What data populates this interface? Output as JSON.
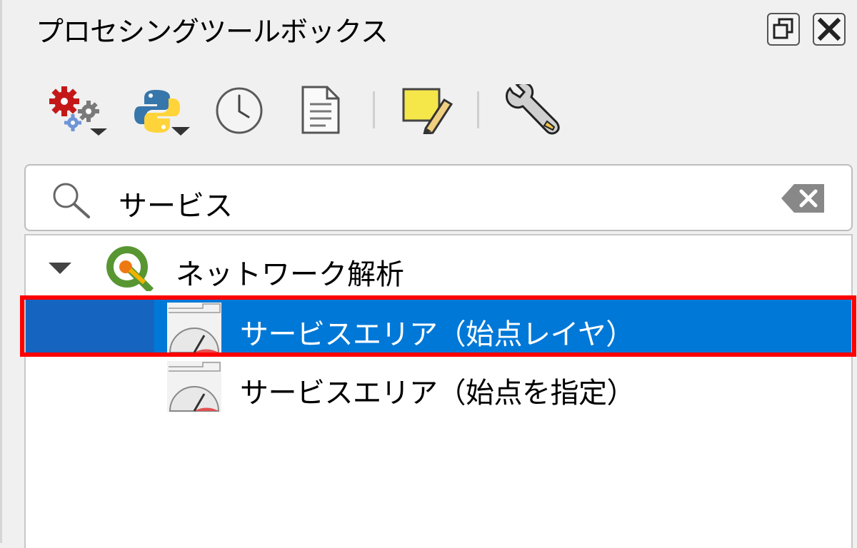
{
  "panel": {
    "title": "プロセシングツールボックス",
    "float_button_icon": "restore-icon",
    "close_button_icon": "close-icon"
  },
  "toolbar": {
    "items": [
      {
        "icon": "models-gear-icon",
        "has_dropdown": true
      },
      {
        "icon": "python-scripts-icon",
        "has_dropdown": true
      },
      {
        "icon": "history-clock-icon",
        "has_dropdown": false
      },
      {
        "icon": "results-document-icon",
        "has_dropdown": false
      },
      {
        "icon": "edit-features-in-place-icon",
        "has_dropdown": false
      },
      {
        "icon": "options-wrench-icon",
        "has_dropdown": false
      }
    ]
  },
  "search": {
    "value": "サービス",
    "clear_icon": "clear-icon"
  },
  "tree": {
    "group": {
      "label": "ネットワーク解析",
      "icon": "qgis-logo-icon",
      "expanded": true
    },
    "items": [
      {
        "label": "サービスエリア（始点レイヤ）",
        "icon": "service-area-gauge-icon",
        "selected": true
      },
      {
        "label": "サービスエリア（始点を指定）",
        "icon": "service-area-gauge-icon",
        "selected": false
      }
    ]
  },
  "colors": {
    "selection": "#0078d7",
    "highlight_frame": "#ff0000"
  }
}
